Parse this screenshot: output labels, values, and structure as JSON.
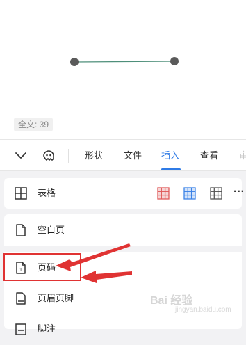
{
  "document": {
    "word_count": "全文: 39"
  },
  "toolbar": {
    "collapse_icon": "chevron-down-icon",
    "assistant_icon": "assistant-face-icon",
    "tabs": [
      {
        "label": "形状"
      },
      {
        "label": "文件"
      },
      {
        "label": "插入"
      },
      {
        "label": "查看"
      },
      {
        "label": "审"
      }
    ],
    "active_tab": "插入",
    "accent_color": "#2f7be6"
  },
  "insert_menu": {
    "table": {
      "label": "表格",
      "more_label": "···",
      "style_colors": [
        "#e05a5a",
        "#3b82e6",
        "#555555"
      ]
    },
    "items": [
      {
        "label": "空白页",
        "icon": "blank-page-icon"
      },
      {
        "label": "页码",
        "icon": "page-number-icon"
      },
      {
        "label": "页眉页脚",
        "icon": "header-footer-icon"
      },
      {
        "label": "脚注",
        "icon": "footnote-icon"
      }
    ]
  },
  "annotation": {
    "highlight_color": "#e03333"
  },
  "watermark": {
    "text": "Bai 经验",
    "sub": "jingyan.baidu.com"
  }
}
